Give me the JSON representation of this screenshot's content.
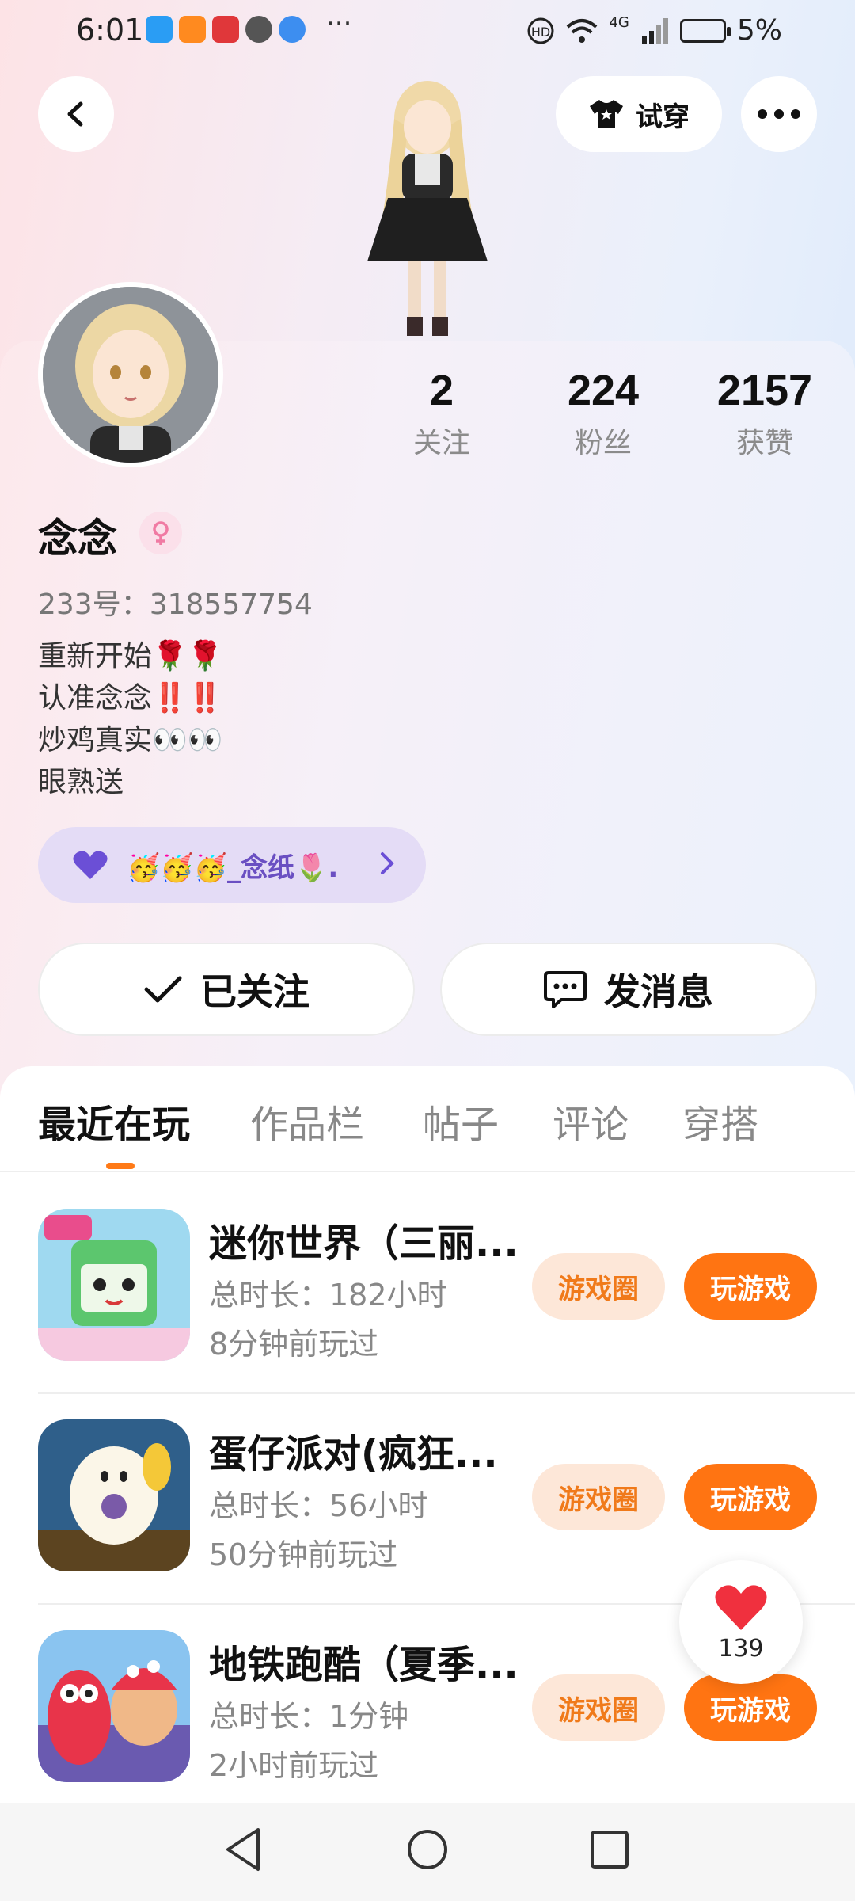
{
  "status_bar": {
    "time": "6:01",
    "more": "···",
    "network": "4G",
    "battery": "5%"
  },
  "header": {
    "try_on_label": "试穿"
  },
  "stats": [
    {
      "value": "2",
      "label": "关注"
    },
    {
      "value": "224",
      "label": "粉丝"
    },
    {
      "value": "2157",
      "label": "获赞"
    }
  ],
  "profile": {
    "username": "念念",
    "uid": "233号：318557754",
    "bio": [
      "重新开始🌹🌹",
      "认准念念‼️‼️",
      "炒鸡真实👀👀",
      "眼熟送"
    ],
    "fan_group": "🥳🥳🥳_念纸🌷."
  },
  "actions": {
    "follow_label": "已关注",
    "message_label": "发消息"
  },
  "tabs": [
    "最近在玩",
    "作品栏",
    "帖子",
    "评论",
    "穿搭"
  ],
  "games": [
    {
      "name": "迷你世界（三丽...",
      "duration": "总时长：182小时",
      "last_played": "8分钟前玩过",
      "circle": "游戏圈",
      "play": "玩游戏"
    },
    {
      "name": "蛋仔派对(疯狂...",
      "duration": "总时长：56小时",
      "last_played": "50分钟前玩过",
      "circle": "游戏圈",
      "play": "玩游戏"
    },
    {
      "name": "地铁跑酷（夏季...",
      "duration": "总时长：1分钟",
      "last_played": "2小时前玩过",
      "circle": "游戏圈",
      "play": "玩游戏"
    }
  ],
  "like_float": {
    "count": "139"
  },
  "colors": {
    "accent": "#ff7412",
    "chip_bg": "#fde7d8",
    "fan_pill": "#e4dcf6"
  }
}
